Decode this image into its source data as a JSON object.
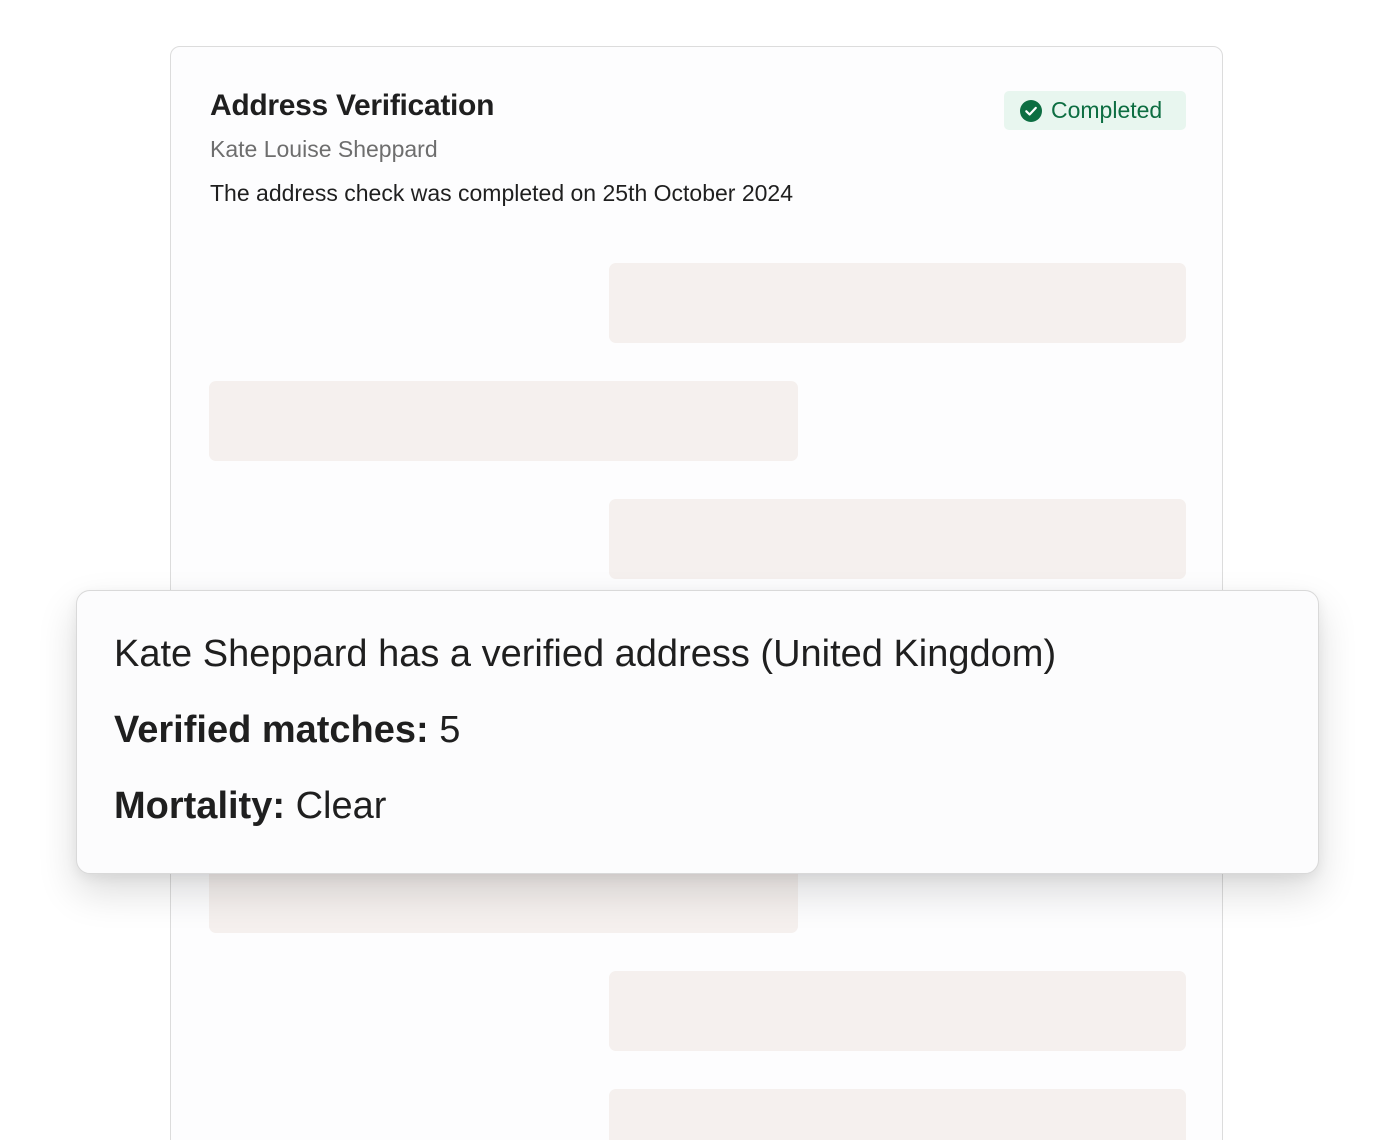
{
  "card": {
    "title": "Address Verification",
    "subtitle": "Kate Louise Sheppard",
    "description": "The address check was completed on 25th October 2024",
    "status": {
      "label": "Completed",
      "icon": "check-circle-icon",
      "color": "#0d6e42",
      "background": "#e8f6ef"
    }
  },
  "popup": {
    "summary": "Kate Sheppard has a verified address (United Kingdom)",
    "verified_matches": {
      "label": "Verified matches",
      "separator": ":",
      "value": "5"
    },
    "mortality": {
      "label": "Mortality",
      "separator": ":",
      "value": "Clear"
    }
  },
  "colors": {
    "skeleton": "#f5f0ee",
    "text": "#1f1f1f",
    "muted": "#6e6e6e"
  }
}
